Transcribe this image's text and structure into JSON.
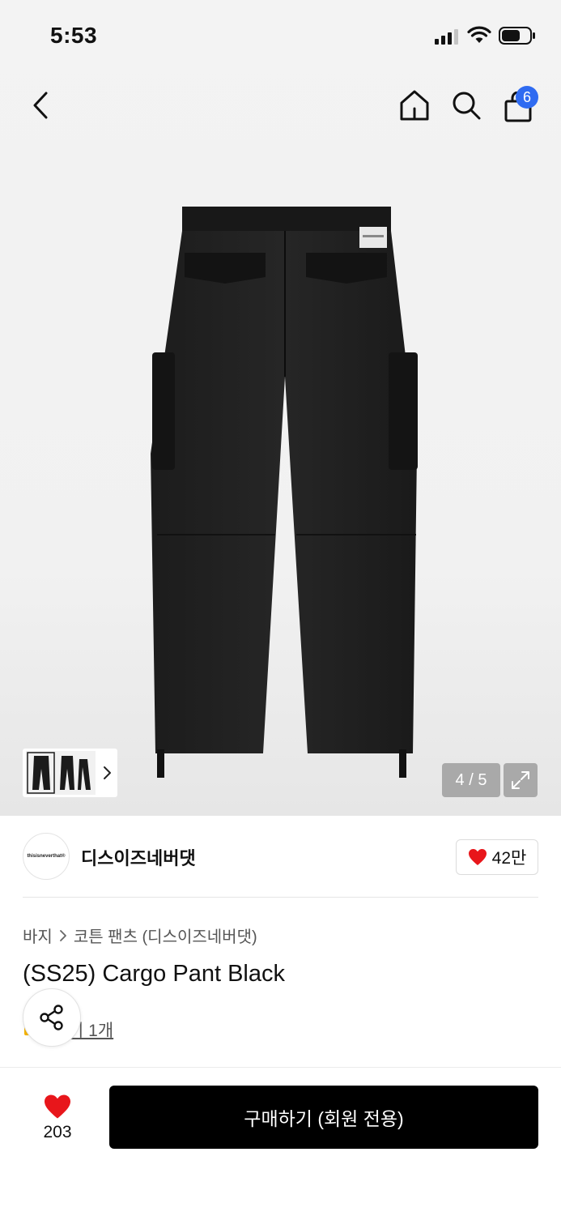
{
  "status_bar": {
    "time": "5:53"
  },
  "header": {
    "cart_count": "6"
  },
  "gallery": {
    "counter": "4 / 5"
  },
  "brand": {
    "name": "디스이즈네버댓",
    "logo_text": "thisisneverthat®",
    "likes": "42만"
  },
  "breadcrumb": {
    "category": "바지",
    "subcategory": "코튼 팬츠 (디스이즈네버댓)"
  },
  "product": {
    "title": "(SS25) Cargo Pant Black",
    "review_link": "후기 1개",
    "review_visible": "기 1개"
  },
  "bottom": {
    "like_count": "203",
    "buy_label": "구매하기 (회원 전용)"
  },
  "colors": {
    "accent_badge": "#2f6bf1",
    "heart": "#e8161b",
    "buy_bg": "#000000"
  }
}
